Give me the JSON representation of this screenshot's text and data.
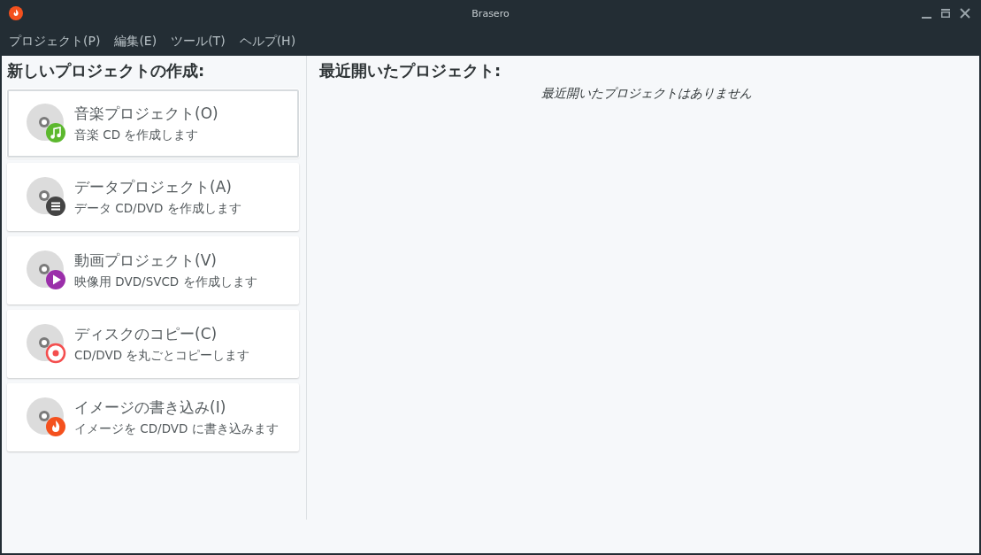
{
  "window": {
    "title": "Brasero"
  },
  "menu": [
    {
      "label": "プロジェクト(P)"
    },
    {
      "label": "編集(E)"
    },
    {
      "label": "ツール(T)"
    },
    {
      "label": "ヘルプ(H)"
    }
  ],
  "new_project": {
    "heading": "新しいプロジェクトの作成:",
    "items": [
      {
        "kind": "music",
        "title": "音楽プロジェクト(O)",
        "description": "音楽 CD を作成します",
        "selected": true
      },
      {
        "kind": "data",
        "title": "データプロジェクト(A)",
        "description": "データ CD/DVD を作成します",
        "selected": false
      },
      {
        "kind": "video",
        "title": "動画プロジェクト(V)",
        "description": "映像用 DVD/SVCD を作成します",
        "selected": false
      },
      {
        "kind": "copy",
        "title": "ディスクのコピー(C)",
        "description": "CD/DVD を丸ごとコピーします",
        "selected": false
      },
      {
        "kind": "burn",
        "title": "イメージの書き込み(I)",
        "description": "イメージを CD/DVD に書き込みます",
        "selected": false
      }
    ]
  },
  "recent": {
    "heading": "最近開いたプロジェクト:",
    "empty_message": "最近開いたプロジェクトはありません"
  }
}
